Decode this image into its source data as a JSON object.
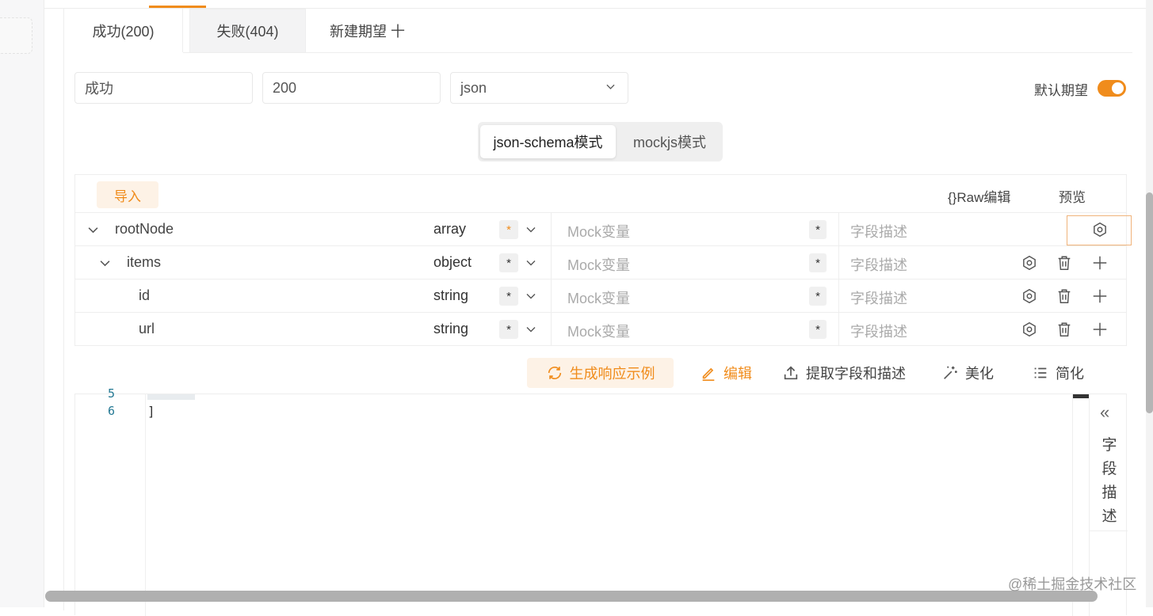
{
  "tabs": [
    {
      "label": "成功(200)",
      "active": true
    },
    {
      "label": "失败(404)",
      "active": false
    },
    {
      "label": "新建期望 十",
      "active": false
    }
  ],
  "form": {
    "name_value": "成功",
    "code_value": "200",
    "format_value": "json",
    "default_label": "默认期望",
    "default_on": true
  },
  "modes": {
    "schema": "json-schema模式",
    "mockjs": "mockjs模式"
  },
  "toolbar": {
    "import": "导入",
    "raw_edit": "{}Raw编辑",
    "preview": "预览"
  },
  "rows": [
    {
      "name": "rootNode",
      "type": "array",
      "required": "*",
      "mock_placeholder": "Mock变量",
      "mock_required": "*",
      "desc_placeholder": "字段描述"
    },
    {
      "name": "items",
      "type": "object",
      "required": "*",
      "mock_placeholder": "Mock变量",
      "mock_required": "*",
      "desc_placeholder": "字段描述"
    },
    {
      "name": "id",
      "type": "string",
      "required": "*",
      "mock_placeholder": "Mock变量",
      "mock_required": "*",
      "desc_placeholder": "字段描述"
    },
    {
      "name": "url",
      "type": "string",
      "required": "*",
      "mock_placeholder": "Mock变量",
      "mock_required": "*",
      "desc_placeholder": "字段描述"
    }
  ],
  "actions": {
    "generate": "生成响应示例",
    "edit": "编辑",
    "extract": "提取字段和描述",
    "beautify": "美化",
    "simplify": "简化"
  },
  "editor": {
    "partial_line_number": "5",
    "line_number": "6",
    "line_code": "]"
  },
  "side_panel": {
    "collapse": "«",
    "title": "字段描述"
  },
  "watermark": "@稀土掘金技术社区",
  "colors": {
    "accent": "#f08c1c"
  }
}
